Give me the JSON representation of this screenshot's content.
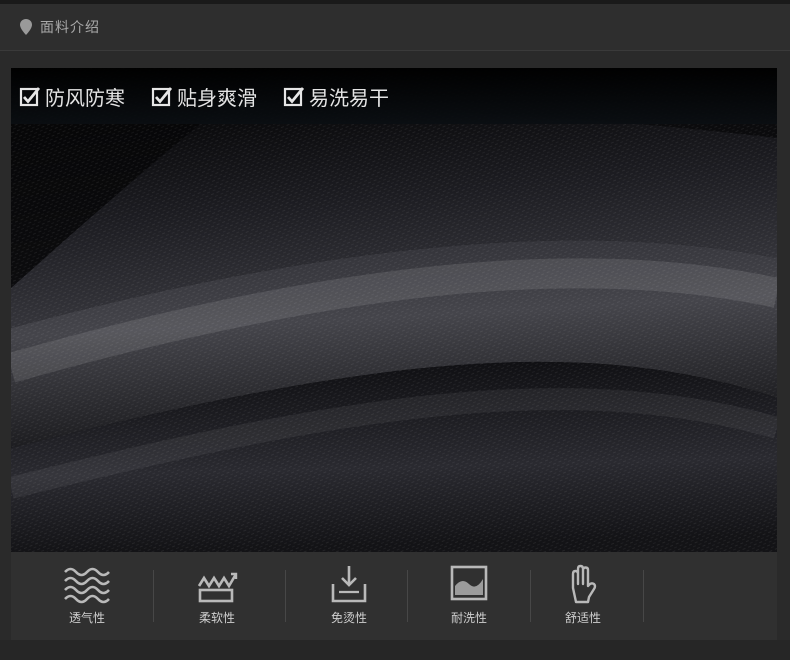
{
  "header": {
    "title": "面料介绍",
    "icon": "location-pin-icon"
  },
  "features": [
    {
      "label": "防风防寒",
      "icon": "checkbox-checked-icon"
    },
    {
      "label": "贴身爽滑",
      "icon": "checkbox-checked-icon"
    },
    {
      "label": "易洗易干",
      "icon": "checkbox-checked-icon"
    }
  ],
  "properties": [
    {
      "label": "透气性",
      "icon": "waves-icon"
    },
    {
      "label": "柔软性",
      "icon": "soft-zigzag-icon"
    },
    {
      "label": "免烫性",
      "icon": "download-tray-icon"
    },
    {
      "label": "耐洗性",
      "icon": "image-frame-icon"
    },
    {
      "label": "舒适性",
      "icon": "hand-icon"
    }
  ],
  "colors": {
    "background": "#2a2a2a",
    "fabric": "#16161a",
    "text": "#cfcfcf"
  }
}
